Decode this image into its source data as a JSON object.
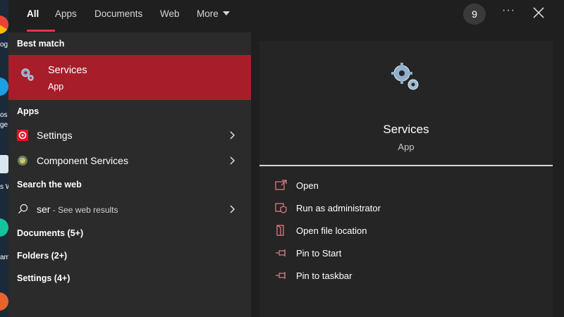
{
  "tabs": [
    {
      "label": "All"
    },
    {
      "label": "Apps"
    },
    {
      "label": "Documents"
    },
    {
      "label": "Web"
    },
    {
      "label": "More"
    }
  ],
  "header": {
    "badge": "9",
    "more_options": "···"
  },
  "best_match": {
    "heading": "Best match",
    "title": "Services",
    "subtitle": "App"
  },
  "apps": {
    "heading": "Apps",
    "items": [
      {
        "label": "Settings"
      },
      {
        "label": "Component Services"
      }
    ]
  },
  "web": {
    "heading": "Search the web",
    "query": "ser",
    "hint": " - See web results"
  },
  "categories": [
    {
      "label": "Documents (5+)"
    },
    {
      "label": "Folders (2+)"
    },
    {
      "label": "Settings (4+)"
    }
  ],
  "preview": {
    "title": "Services",
    "type": "App",
    "actions": [
      {
        "label": "Open"
      },
      {
        "label": "Run as administrator"
      },
      {
        "label": "Open file location"
      },
      {
        "label": "Pin to Start"
      },
      {
        "label": "Pin to taskbar"
      }
    ]
  },
  "desktop": {
    "fragments": [
      "og",
      "os",
      "ge",
      "s W",
      "am"
    ]
  },
  "colors": {
    "accent": "#a71d2a",
    "tab_indicator": "#e8334a",
    "action_icon": "#e87d86"
  }
}
